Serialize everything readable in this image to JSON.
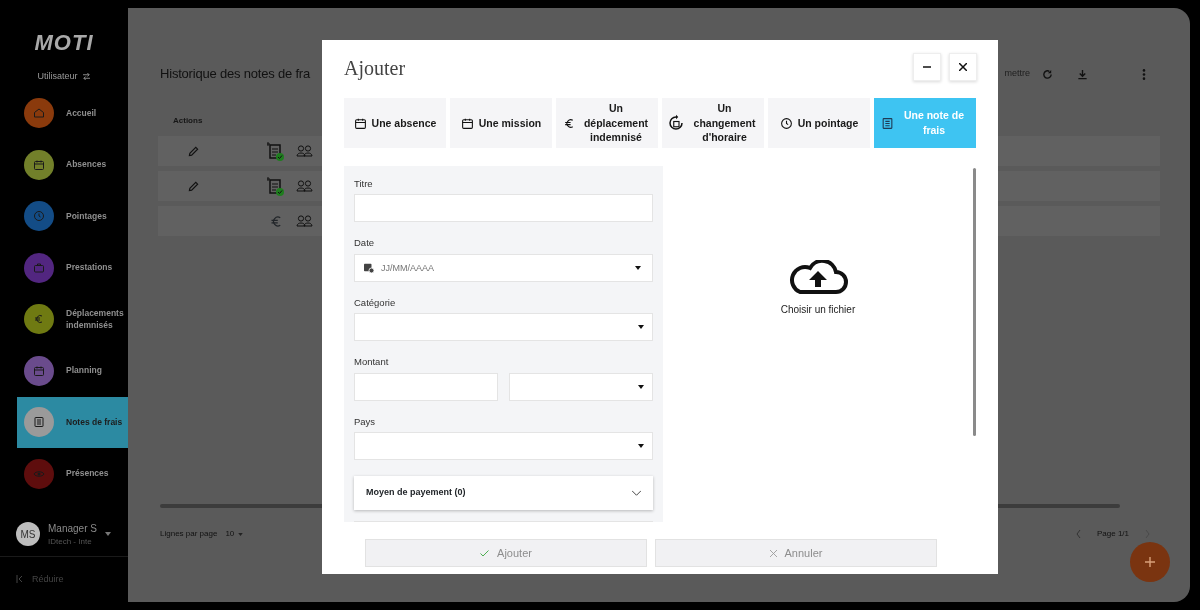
{
  "sidebar": {
    "logo": "MOTI",
    "user_switch": "Utilisateur",
    "items": [
      {
        "label": "Accueil",
        "color": "#8a3a0c",
        "selected": false
      },
      {
        "label": "Absences",
        "color": "#72802a",
        "selected": false
      },
      {
        "label": "Pointages",
        "color": "#134c86",
        "selected": false
      },
      {
        "label": "Prestations",
        "color": "#522680",
        "selected": false
      },
      {
        "label": "Déplacements indemnisés",
        "color": "#6f7a12",
        "selected": false
      },
      {
        "label": "Planning",
        "color": "#6a4b8c",
        "selected": false
      },
      {
        "label": "Notes de frais",
        "color": "#9a9a9a",
        "selected": true
      },
      {
        "label": "Présences",
        "color": "#5e0d0d",
        "selected": false
      }
    ],
    "user": {
      "initials": "MS",
      "name": "Manager S",
      "company": "IDtech - Inte"
    },
    "collapse": "Réduire"
  },
  "page": {
    "title": "Historique des notes de fra",
    "toolbar_text": "mettre",
    "table": {
      "columns": [
        "Actions"
      ],
      "rows": [
        {
          "editable": true,
          "kind": "approved"
        },
        {
          "editable": true,
          "kind": "approved"
        },
        {
          "editable": false,
          "kind": "euro"
        }
      ]
    },
    "rows_per_page_label": "Lignes par page",
    "rows_per_page": "10",
    "page_indicator": "Page 1/1"
  },
  "modal": {
    "title": "Ajouter",
    "tabs": [
      {
        "label": "Une absence",
        "selected": false
      },
      {
        "label": "Une mission",
        "selected": false
      },
      {
        "label": "Un déplacement indemnisé",
        "selected": false
      },
      {
        "label": "Un changement d'horaire",
        "selected": false
      },
      {
        "label": "Un pointage",
        "selected": false
      },
      {
        "label": "Une note de frais",
        "selected": true
      }
    ],
    "fields": [
      {
        "label": "Titre",
        "kind": "text"
      },
      {
        "label": "Date",
        "kind": "date",
        "placeholder": "JJ/MM/AAAA"
      },
      {
        "label": "Catégorie",
        "kind": "select"
      },
      {
        "label": "Montant",
        "kind": "amount"
      },
      {
        "label": "Pays",
        "kind": "select"
      }
    ],
    "accordion": {
      "label": "Moyen de payement (0)",
      "expanded": false
    },
    "upload": "Choisir un fichier",
    "buttons": [
      {
        "label": "Ajouter",
        "kind": "confirm",
        "disabled": true
      },
      {
        "label": "Annuler",
        "kind": "cancel",
        "disabled": true
      }
    ]
  }
}
